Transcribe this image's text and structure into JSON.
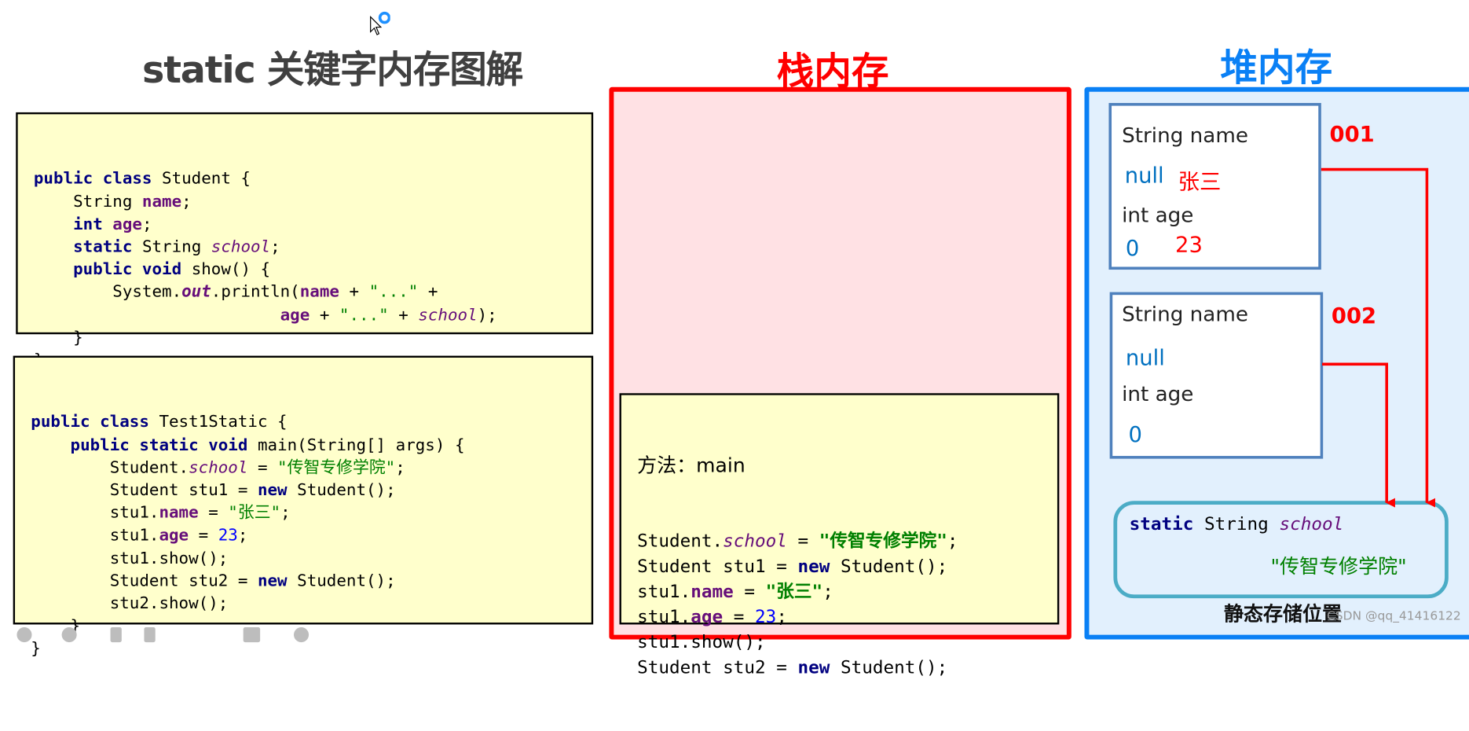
{
  "title": {
    "main": "static 关键字内存图解",
    "stack": "栈内存",
    "heap": "堆内存"
  },
  "student_class": {
    "lines": [
      [
        {
          "t": "public class",
          "c": "kw"
        },
        {
          "t": " Student {",
          "c": ""
        }
      ],
      [
        {
          "t": "    String ",
          "c": ""
        },
        {
          "t": "name",
          "c": "fld"
        },
        {
          "t": ";",
          "c": ""
        }
      ],
      [
        {
          "t": "    ",
          "c": ""
        },
        {
          "t": "int",
          "c": "kw"
        },
        {
          "t": " ",
          "c": ""
        },
        {
          "t": "age",
          "c": "fld"
        },
        {
          "t": ";",
          "c": ""
        }
      ],
      [
        {
          "t": "    ",
          "c": ""
        },
        {
          "t": "static",
          "c": "kw"
        },
        {
          "t": " String ",
          "c": ""
        },
        {
          "t": "school",
          "c": "sfld"
        },
        {
          "t": ";",
          "c": ""
        }
      ],
      [
        {
          "t": "    ",
          "c": ""
        },
        {
          "t": "public void",
          "c": "kw"
        },
        {
          "t": " show() {",
          "c": ""
        }
      ],
      [
        {
          "t": "        System.",
          "c": ""
        },
        {
          "t": "out",
          "c": "sfld kwb"
        },
        {
          "t": ".println(",
          "c": ""
        },
        {
          "t": "name",
          "c": "fld"
        },
        {
          "t": " + ",
          "c": ""
        },
        {
          "t": "\"...\"",
          "c": "str"
        },
        {
          "t": " +",
          "c": ""
        }
      ],
      [
        {
          "t": "                         ",
          "c": ""
        },
        {
          "t": "age",
          "c": "fld"
        },
        {
          "t": " + ",
          "c": ""
        },
        {
          "t": "\"...\"",
          "c": "str"
        },
        {
          "t": " + ",
          "c": ""
        },
        {
          "t": "school",
          "c": "sfld"
        },
        {
          "t": ");",
          "c": ""
        }
      ],
      [
        {
          "t": "    }",
          "c": ""
        }
      ],
      [
        {
          "t": "}",
          "c": ""
        }
      ]
    ]
  },
  "test_class": {
    "lines": [
      [
        {
          "t": "public class",
          "c": "kw"
        },
        {
          "t": " Test1Static {",
          "c": ""
        }
      ],
      [
        {
          "t": "    ",
          "c": ""
        },
        {
          "t": "public static void",
          "c": "kw"
        },
        {
          "t": " main(String[] args) {",
          "c": ""
        }
      ],
      [
        {
          "t": "        Student.",
          "c": ""
        },
        {
          "t": "school",
          "c": "sfld"
        },
        {
          "t": " = ",
          "c": ""
        },
        {
          "t": "\"传智专修学院\"",
          "c": "str"
        },
        {
          "t": ";",
          "c": ""
        }
      ],
      [
        {
          "t": "        Student stu1 = ",
          "c": ""
        },
        {
          "t": "new",
          "c": "kw"
        },
        {
          "t": " Student();",
          "c": ""
        }
      ],
      [
        {
          "t": "        stu1.",
          "c": ""
        },
        {
          "t": "name",
          "c": "fld"
        },
        {
          "t": " = ",
          "c": ""
        },
        {
          "t": "\"张三\"",
          "c": "str"
        },
        {
          "t": ";",
          "c": ""
        }
      ],
      [
        {
          "t": "        stu1.",
          "c": ""
        },
        {
          "t": "age",
          "c": "fld"
        },
        {
          "t": " = ",
          "c": ""
        },
        {
          "t": "23",
          "c": "num"
        },
        {
          "t": ";",
          "c": ""
        }
      ],
      [
        {
          "t": "        stu1.show();",
          "c": ""
        }
      ],
      [
        {
          "t": "        Student stu2 = ",
          "c": ""
        },
        {
          "t": "new",
          "c": "kw"
        },
        {
          "t": " Student();",
          "c": ""
        }
      ],
      [
        {
          "t": "        stu2.show();",
          "c": ""
        }
      ],
      [
        {
          "t": "    }",
          "c": ""
        }
      ],
      [
        {
          "t": "}",
          "c": ""
        }
      ]
    ]
  },
  "stack_frame": {
    "title": "方法：main",
    "lines": [
      [
        {
          "t": "Student.",
          "c": ""
        },
        {
          "t": "school",
          "c": "sfld"
        },
        {
          "t": " = ",
          "c": ""
        },
        {
          "t": "\"传智专修学院\"",
          "c": "strb"
        },
        {
          "t": ";",
          "c": ""
        }
      ],
      [
        {
          "t": "Student stu1 = ",
          "c": ""
        },
        {
          "t": "new",
          "c": "kw"
        },
        {
          "t": " Student();",
          "c": ""
        }
      ],
      [
        {
          "t": "stu1.",
          "c": ""
        },
        {
          "t": "name",
          "c": "fld"
        },
        {
          "t": " = ",
          "c": ""
        },
        {
          "t": "\"张三\"",
          "c": "strb"
        },
        {
          "t": ";",
          "c": ""
        }
      ],
      [
        {
          "t": "stu1.",
          "c": ""
        },
        {
          "t": "age",
          "c": "fld"
        },
        {
          "t": " = ",
          "c": ""
        },
        {
          "t": "23",
          "c": "num"
        },
        {
          "t": ";",
          "c": ""
        }
      ],
      [
        {
          "t": "stu1.show();",
          "c": ""
        }
      ],
      [
        {
          "t": "Student stu2 = ",
          "c": ""
        },
        {
          "t": "new",
          "c": "kw"
        },
        {
          "t": " Student();",
          "c": ""
        }
      ]
    ]
  },
  "heap": {
    "objects": [
      {
        "address": "001",
        "name_label": "String name",
        "name_default": "null",
        "name_value": "张三",
        "age_label": "int age",
        "age_default": "0",
        "age_value": "23"
      },
      {
        "address": "002",
        "name_label": "String name",
        "name_default": "null",
        "name_value": "",
        "age_label": "int age",
        "age_default": "0",
        "age_value": ""
      }
    ],
    "static_area": {
      "keyword": "static",
      "type": "String",
      "field": "school",
      "value": "\"传智专修学院\"",
      "caption": "静态存储位置"
    }
  },
  "watermark": "CSDN @qq_41416122",
  "colors": {
    "stack_border": "#ff0000",
    "stack_bg": "#ffe1e4",
    "heap_border": "#0a80f5",
    "heap_bg": "#e2f0fd",
    "code_bg": "#ffffcc",
    "arrow": "#ff0000"
  }
}
